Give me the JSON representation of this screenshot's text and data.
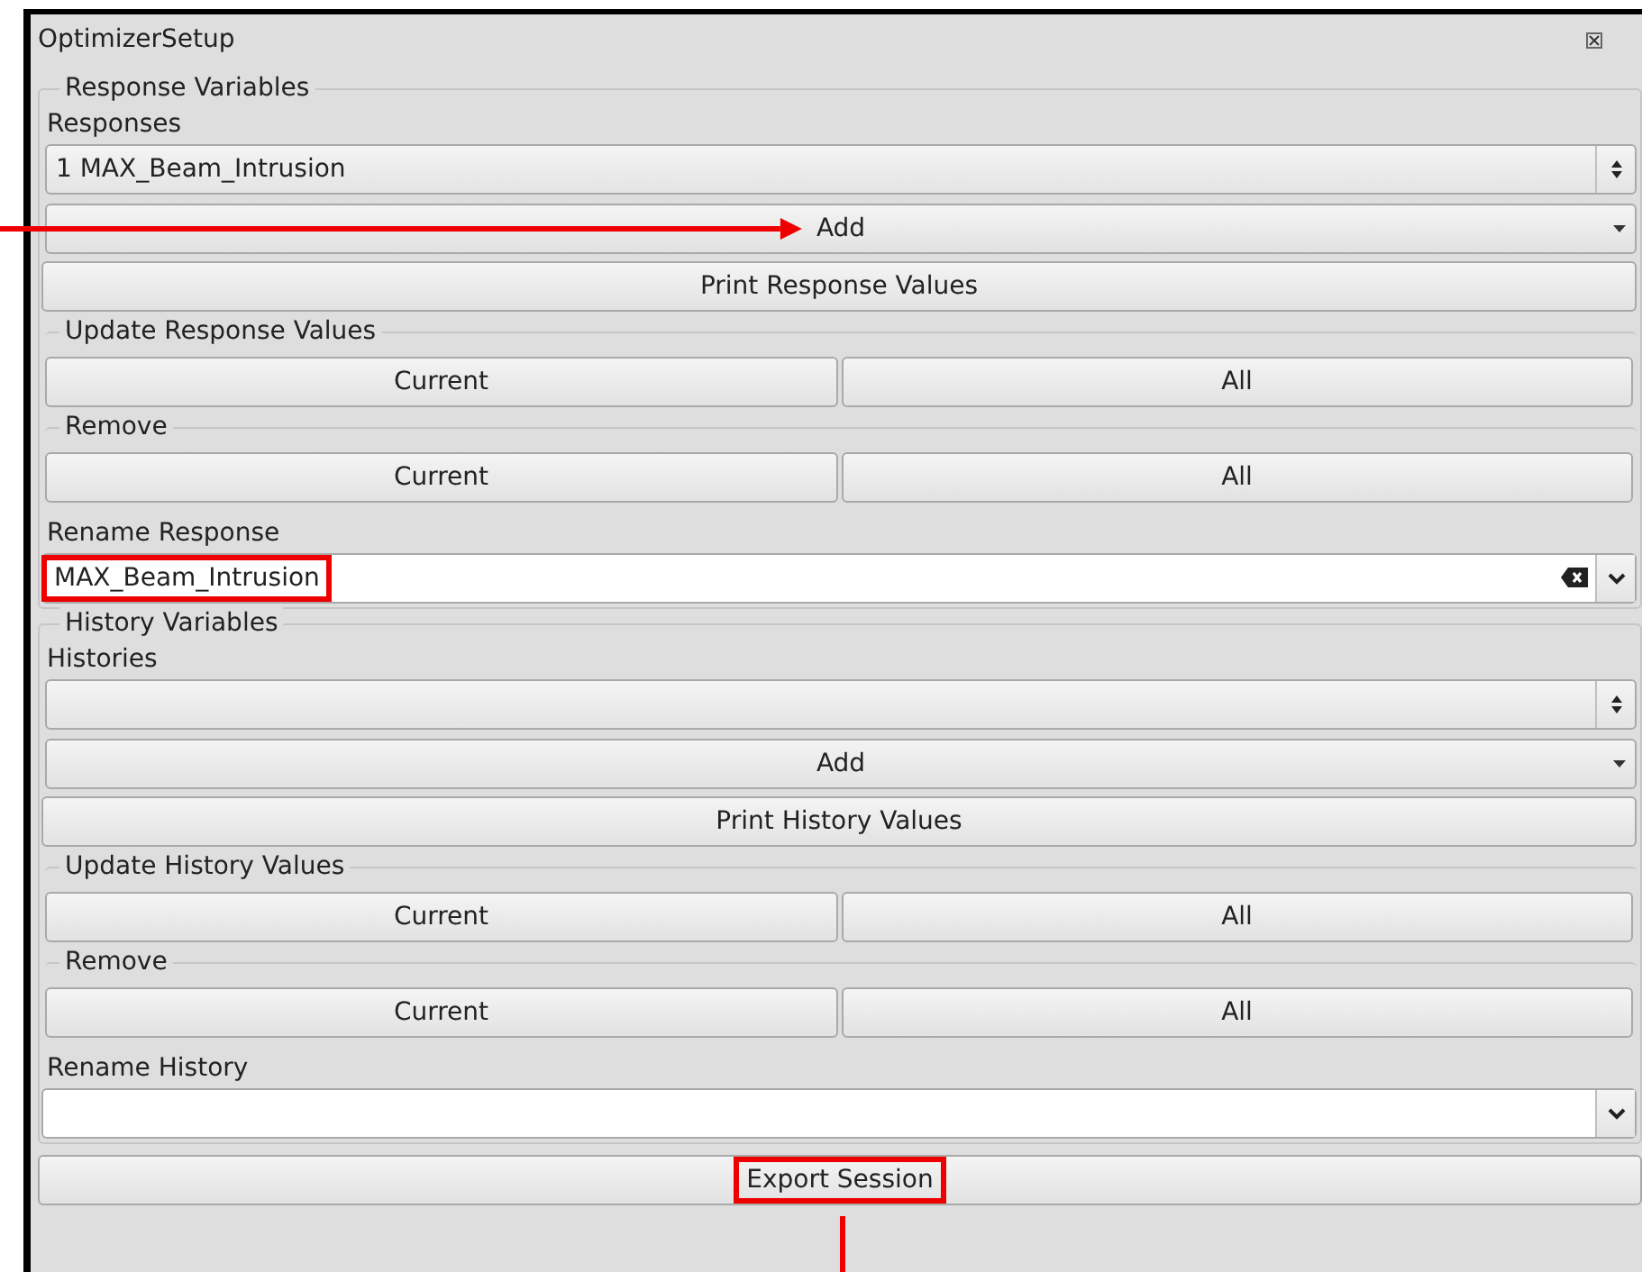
{
  "window": {
    "title": "OptimizerSetup"
  },
  "sections": [
    {
      "legend": "Response Variables",
      "label": "Responses",
      "selector": {
        "value": "1 MAX_Beam_Intrusion"
      },
      "add_button": {
        "label": "Add",
        "pointed_at": true
      },
      "print_button": {
        "label": "Print Response Values"
      },
      "groups": [
        {
          "legend": "Update Response Values",
          "buttons": [
            "Current",
            "All"
          ]
        },
        {
          "legend": "Remove",
          "buttons": [
            "Current",
            "All"
          ]
        }
      ],
      "rename": {
        "label": "Rename Response",
        "value": "MAX_Beam_Intrusion",
        "highlighted": true,
        "clear_button": true
      }
    },
    {
      "legend": "History Variables",
      "label": "Histories",
      "add_button": {
        "label": "Add",
        "pointed_at": false
      },
      "print_button": {
        "label": "Print History Values"
      },
      "groups": [
        {
          "legend": "Update History Values",
          "buttons": [
            "Current",
            "All"
          ]
        },
        {
          "legend": "Remove",
          "buttons": [
            "Current",
            "All"
          ]
        }
      ],
      "rename": {
        "label": "Rename History",
        "highlighted": false,
        "clear_button": false
      }
    }
  ],
  "export_button": {
    "label": "Export Session",
    "highlighted": true
  }
}
